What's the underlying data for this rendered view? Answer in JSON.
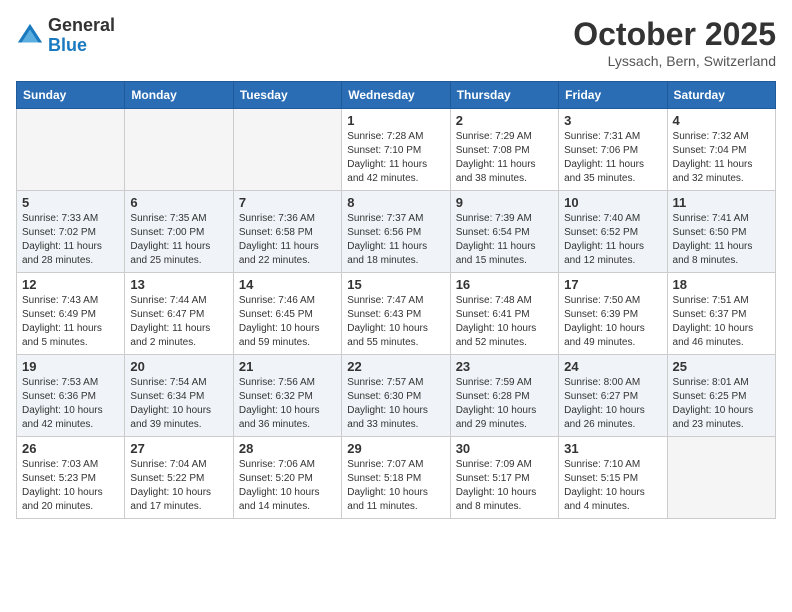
{
  "header": {
    "logo": {
      "general": "General",
      "blue": "Blue"
    },
    "month": "October 2025",
    "location": "Lyssach, Bern, Switzerland"
  },
  "days_of_week": [
    "Sunday",
    "Monday",
    "Tuesday",
    "Wednesday",
    "Thursday",
    "Friday",
    "Saturday"
  ],
  "weeks": [
    [
      {
        "num": "",
        "info": ""
      },
      {
        "num": "",
        "info": ""
      },
      {
        "num": "",
        "info": ""
      },
      {
        "num": "1",
        "info": "Sunrise: 7:28 AM\nSunset: 7:10 PM\nDaylight: 11 hours\nand 42 minutes."
      },
      {
        "num": "2",
        "info": "Sunrise: 7:29 AM\nSunset: 7:08 PM\nDaylight: 11 hours\nand 38 minutes."
      },
      {
        "num": "3",
        "info": "Sunrise: 7:31 AM\nSunset: 7:06 PM\nDaylight: 11 hours\nand 35 minutes."
      },
      {
        "num": "4",
        "info": "Sunrise: 7:32 AM\nSunset: 7:04 PM\nDaylight: 11 hours\nand 32 minutes."
      }
    ],
    [
      {
        "num": "5",
        "info": "Sunrise: 7:33 AM\nSunset: 7:02 PM\nDaylight: 11 hours\nand 28 minutes."
      },
      {
        "num": "6",
        "info": "Sunrise: 7:35 AM\nSunset: 7:00 PM\nDaylight: 11 hours\nand 25 minutes."
      },
      {
        "num": "7",
        "info": "Sunrise: 7:36 AM\nSunset: 6:58 PM\nDaylight: 11 hours\nand 22 minutes."
      },
      {
        "num": "8",
        "info": "Sunrise: 7:37 AM\nSunset: 6:56 PM\nDaylight: 11 hours\nand 18 minutes."
      },
      {
        "num": "9",
        "info": "Sunrise: 7:39 AM\nSunset: 6:54 PM\nDaylight: 11 hours\nand 15 minutes."
      },
      {
        "num": "10",
        "info": "Sunrise: 7:40 AM\nSunset: 6:52 PM\nDaylight: 11 hours\nand 12 minutes."
      },
      {
        "num": "11",
        "info": "Sunrise: 7:41 AM\nSunset: 6:50 PM\nDaylight: 11 hours\nand 8 minutes."
      }
    ],
    [
      {
        "num": "12",
        "info": "Sunrise: 7:43 AM\nSunset: 6:49 PM\nDaylight: 11 hours\nand 5 minutes."
      },
      {
        "num": "13",
        "info": "Sunrise: 7:44 AM\nSunset: 6:47 PM\nDaylight: 11 hours\nand 2 minutes."
      },
      {
        "num": "14",
        "info": "Sunrise: 7:46 AM\nSunset: 6:45 PM\nDaylight: 10 hours\nand 59 minutes."
      },
      {
        "num": "15",
        "info": "Sunrise: 7:47 AM\nSunset: 6:43 PM\nDaylight: 10 hours\nand 55 minutes."
      },
      {
        "num": "16",
        "info": "Sunrise: 7:48 AM\nSunset: 6:41 PM\nDaylight: 10 hours\nand 52 minutes."
      },
      {
        "num": "17",
        "info": "Sunrise: 7:50 AM\nSunset: 6:39 PM\nDaylight: 10 hours\nand 49 minutes."
      },
      {
        "num": "18",
        "info": "Sunrise: 7:51 AM\nSunset: 6:37 PM\nDaylight: 10 hours\nand 46 minutes."
      }
    ],
    [
      {
        "num": "19",
        "info": "Sunrise: 7:53 AM\nSunset: 6:36 PM\nDaylight: 10 hours\nand 42 minutes."
      },
      {
        "num": "20",
        "info": "Sunrise: 7:54 AM\nSunset: 6:34 PM\nDaylight: 10 hours\nand 39 minutes."
      },
      {
        "num": "21",
        "info": "Sunrise: 7:56 AM\nSunset: 6:32 PM\nDaylight: 10 hours\nand 36 minutes."
      },
      {
        "num": "22",
        "info": "Sunrise: 7:57 AM\nSunset: 6:30 PM\nDaylight: 10 hours\nand 33 minutes."
      },
      {
        "num": "23",
        "info": "Sunrise: 7:59 AM\nSunset: 6:28 PM\nDaylight: 10 hours\nand 29 minutes."
      },
      {
        "num": "24",
        "info": "Sunrise: 8:00 AM\nSunset: 6:27 PM\nDaylight: 10 hours\nand 26 minutes."
      },
      {
        "num": "25",
        "info": "Sunrise: 8:01 AM\nSunset: 6:25 PM\nDaylight: 10 hours\nand 23 minutes."
      }
    ],
    [
      {
        "num": "26",
        "info": "Sunrise: 7:03 AM\nSunset: 5:23 PM\nDaylight: 10 hours\nand 20 minutes."
      },
      {
        "num": "27",
        "info": "Sunrise: 7:04 AM\nSunset: 5:22 PM\nDaylight: 10 hours\nand 17 minutes."
      },
      {
        "num": "28",
        "info": "Sunrise: 7:06 AM\nSunset: 5:20 PM\nDaylight: 10 hours\nand 14 minutes."
      },
      {
        "num": "29",
        "info": "Sunrise: 7:07 AM\nSunset: 5:18 PM\nDaylight: 10 hours\nand 11 minutes."
      },
      {
        "num": "30",
        "info": "Sunrise: 7:09 AM\nSunset: 5:17 PM\nDaylight: 10 hours\nand 8 minutes."
      },
      {
        "num": "31",
        "info": "Sunrise: 7:10 AM\nSunset: 5:15 PM\nDaylight: 10 hours\nand 4 minutes."
      },
      {
        "num": "",
        "info": ""
      }
    ]
  ]
}
